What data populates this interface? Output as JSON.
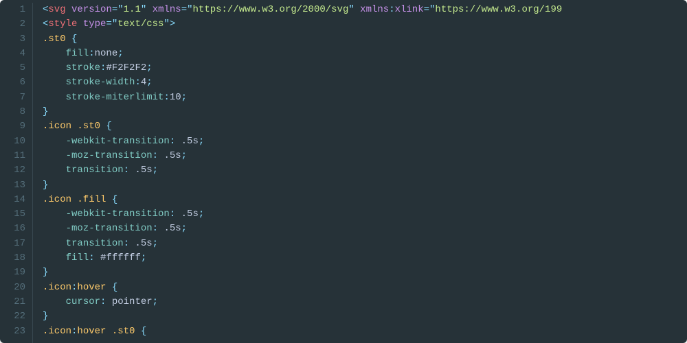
{
  "editor": {
    "language": "svg+css",
    "theme": {
      "bg": "#263238",
      "gutter_fg": "#546e7a",
      "gutter_rule": "#37474f",
      "punct": "#89ddff",
      "tag": "#f07178",
      "attr": "#c792ea",
      "string": "#c3e88d",
      "selector": "#ffcb6b",
      "prop": "#80cbc4",
      "value": "#c3cee3"
    },
    "line_start": 1,
    "line_end": 23,
    "lines": [
      {
        "n": 1,
        "tokens": [
          {
            "t": "pun",
            "v": "<"
          },
          {
            "t": "tag",
            "v": "svg"
          },
          {
            "t": "val",
            "v": " "
          },
          {
            "t": "attr",
            "v": "version"
          },
          {
            "t": "pun",
            "v": "="
          },
          {
            "t": "pun",
            "v": "\""
          },
          {
            "t": "str",
            "v": "1.1"
          },
          {
            "t": "pun",
            "v": "\""
          },
          {
            "t": "val",
            "v": " "
          },
          {
            "t": "attr",
            "v": "xmlns"
          },
          {
            "t": "pun",
            "v": "="
          },
          {
            "t": "pun",
            "v": "\""
          },
          {
            "t": "str",
            "v": "https://www.w3.org/2000/svg"
          },
          {
            "t": "pun",
            "v": "\""
          },
          {
            "t": "val",
            "v": " "
          },
          {
            "t": "attr",
            "v": "xmlns"
          },
          {
            "t": "pun",
            "v": ":"
          },
          {
            "t": "ns",
            "v": "xlink"
          },
          {
            "t": "pun",
            "v": "="
          },
          {
            "t": "pun",
            "v": "\""
          },
          {
            "t": "str",
            "v": "https://www.w3.org/199"
          }
        ]
      },
      {
        "n": 2,
        "tokens": [
          {
            "t": "pun",
            "v": "<"
          },
          {
            "t": "tag",
            "v": "style"
          },
          {
            "t": "val",
            "v": " "
          },
          {
            "t": "attr",
            "v": "type"
          },
          {
            "t": "pun",
            "v": "="
          },
          {
            "t": "pun",
            "v": "\""
          },
          {
            "t": "str",
            "v": "text/css"
          },
          {
            "t": "pun",
            "v": "\""
          },
          {
            "t": "pun",
            "v": ">"
          }
        ]
      },
      {
        "n": 3,
        "tokens": [
          {
            "t": "sel",
            "v": ".st0"
          },
          {
            "t": "val",
            "v": " "
          },
          {
            "t": "pun",
            "v": "{"
          }
        ]
      },
      {
        "n": 4,
        "tokens": [
          {
            "t": "val",
            "v": "    "
          },
          {
            "t": "prop",
            "v": "fill"
          },
          {
            "t": "pun",
            "v": ":"
          },
          {
            "t": "val",
            "v": "none"
          },
          {
            "t": "pun",
            "v": ";"
          }
        ]
      },
      {
        "n": 5,
        "tokens": [
          {
            "t": "val",
            "v": "    "
          },
          {
            "t": "prop",
            "v": "stroke"
          },
          {
            "t": "pun",
            "v": ":"
          },
          {
            "t": "hex",
            "v": "#F2F2F2"
          },
          {
            "t": "pun",
            "v": ";"
          }
        ]
      },
      {
        "n": 6,
        "tokens": [
          {
            "t": "val",
            "v": "    "
          },
          {
            "t": "prop",
            "v": "stroke-width"
          },
          {
            "t": "pun",
            "v": ":"
          },
          {
            "t": "val",
            "v": "4"
          },
          {
            "t": "pun",
            "v": ";"
          }
        ]
      },
      {
        "n": 7,
        "tokens": [
          {
            "t": "val",
            "v": "    "
          },
          {
            "t": "prop",
            "v": "stroke-miterlimit"
          },
          {
            "t": "pun",
            "v": ":"
          },
          {
            "t": "val",
            "v": "10"
          },
          {
            "t": "pun",
            "v": ";"
          }
        ]
      },
      {
        "n": 8,
        "tokens": [
          {
            "t": "pun",
            "v": "}"
          }
        ]
      },
      {
        "n": 9,
        "tokens": [
          {
            "t": "sel",
            "v": ".icon .st0"
          },
          {
            "t": "val",
            "v": " "
          },
          {
            "t": "pun",
            "v": "{"
          }
        ]
      },
      {
        "n": 10,
        "tokens": [
          {
            "t": "val",
            "v": "    "
          },
          {
            "t": "prop",
            "v": "-webkit-transition"
          },
          {
            "t": "pun",
            "v": ":"
          },
          {
            "t": "val",
            "v": " .5s"
          },
          {
            "t": "pun",
            "v": ";"
          }
        ]
      },
      {
        "n": 11,
        "tokens": [
          {
            "t": "val",
            "v": "    "
          },
          {
            "t": "prop",
            "v": "-moz-transition"
          },
          {
            "t": "pun",
            "v": ":"
          },
          {
            "t": "val",
            "v": " .5s"
          },
          {
            "t": "pun",
            "v": ";"
          }
        ]
      },
      {
        "n": 12,
        "tokens": [
          {
            "t": "val",
            "v": "    "
          },
          {
            "t": "prop",
            "v": "transition"
          },
          {
            "t": "pun",
            "v": ":"
          },
          {
            "t": "val",
            "v": " .5s"
          },
          {
            "t": "pun",
            "v": ";"
          }
        ]
      },
      {
        "n": 13,
        "tokens": [
          {
            "t": "pun",
            "v": "}"
          }
        ]
      },
      {
        "n": 14,
        "tokens": [
          {
            "t": "sel",
            "v": ".icon .fill"
          },
          {
            "t": "val",
            "v": " "
          },
          {
            "t": "pun",
            "v": "{"
          }
        ]
      },
      {
        "n": 15,
        "tokens": [
          {
            "t": "val",
            "v": "    "
          },
          {
            "t": "prop",
            "v": "-webkit-transition"
          },
          {
            "t": "pun",
            "v": ":"
          },
          {
            "t": "val",
            "v": " .5s"
          },
          {
            "t": "pun",
            "v": ";"
          }
        ]
      },
      {
        "n": 16,
        "tokens": [
          {
            "t": "val",
            "v": "    "
          },
          {
            "t": "prop",
            "v": "-moz-transition"
          },
          {
            "t": "pun",
            "v": ":"
          },
          {
            "t": "val",
            "v": " .5s"
          },
          {
            "t": "pun",
            "v": ";"
          }
        ]
      },
      {
        "n": 17,
        "tokens": [
          {
            "t": "val",
            "v": "    "
          },
          {
            "t": "prop",
            "v": "transition"
          },
          {
            "t": "pun",
            "v": ":"
          },
          {
            "t": "val",
            "v": " .5s"
          },
          {
            "t": "pun",
            "v": ";"
          }
        ]
      },
      {
        "n": 18,
        "tokens": [
          {
            "t": "val",
            "v": "    "
          },
          {
            "t": "prop",
            "v": "fill"
          },
          {
            "t": "pun",
            "v": ":"
          },
          {
            "t": "val",
            "v": " "
          },
          {
            "t": "hex",
            "v": "#ffffff"
          },
          {
            "t": "pun",
            "v": ";"
          }
        ]
      },
      {
        "n": 19,
        "tokens": [
          {
            "t": "pun",
            "v": "}"
          }
        ]
      },
      {
        "n": 20,
        "tokens": [
          {
            "t": "sel",
            "v": ".icon"
          },
          {
            "t": "pun",
            "v": ":"
          },
          {
            "t": "sel",
            "v": "hover"
          },
          {
            "t": "val",
            "v": " "
          },
          {
            "t": "pun",
            "v": "{"
          }
        ]
      },
      {
        "n": 21,
        "tokens": [
          {
            "t": "val",
            "v": "    "
          },
          {
            "t": "prop",
            "v": "cursor"
          },
          {
            "t": "pun",
            "v": ":"
          },
          {
            "t": "val",
            "v": " pointer"
          },
          {
            "t": "pun",
            "v": ";"
          }
        ]
      },
      {
        "n": 22,
        "tokens": [
          {
            "t": "pun",
            "v": "}"
          }
        ]
      },
      {
        "n": 23,
        "tokens": [
          {
            "t": "sel",
            "v": ".icon"
          },
          {
            "t": "pun",
            "v": ":"
          },
          {
            "t": "sel",
            "v": "hover .st0"
          },
          {
            "t": "val",
            "v": " "
          },
          {
            "t": "pun",
            "v": "{"
          }
        ]
      }
    ]
  }
}
